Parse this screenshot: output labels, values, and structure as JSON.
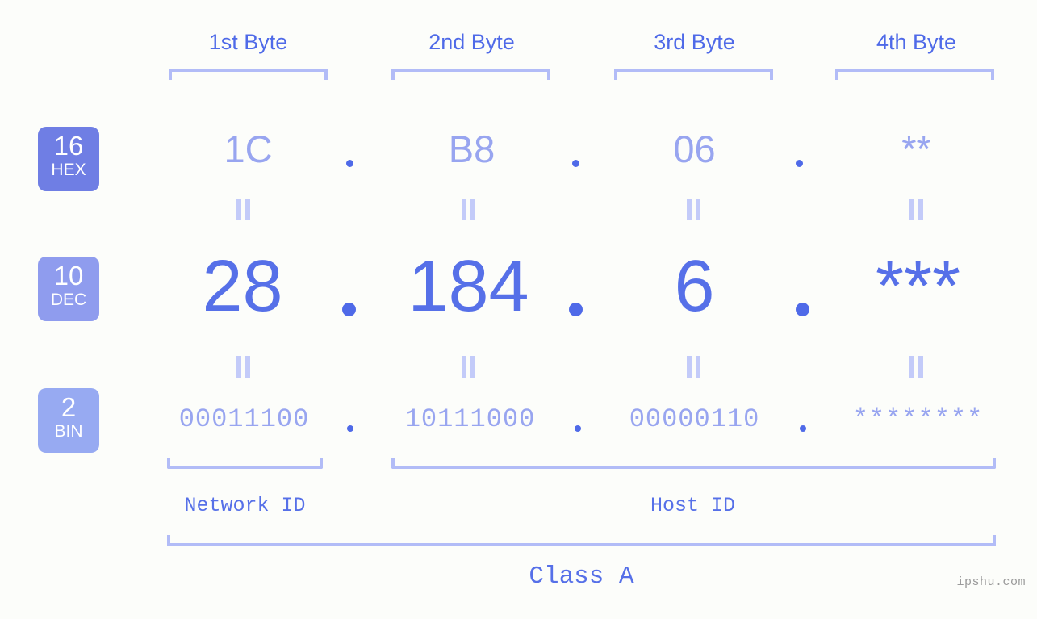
{
  "background_color": "#fcfdfa",
  "accent_colors": {
    "strong_blue": "#5670e8",
    "mid_blue": "#98a5f0",
    "light_lavender": "#b2bcf7",
    "badge_hex": "#6f7ee4",
    "badge_dec": "#8f9cee",
    "badge_bin": "#97aaf2",
    "dot": "#4f6ae8",
    "watermark": "#9a9a9a"
  },
  "byte_headers": [
    {
      "label": "1st Byte"
    },
    {
      "label": "2nd Byte"
    },
    {
      "label": "3rd Byte"
    },
    {
      "label": "4th Byte"
    }
  ],
  "bases": [
    {
      "number": "16",
      "name": "HEX"
    },
    {
      "number": "10",
      "name": "DEC"
    },
    {
      "number": "2",
      "name": "BIN"
    }
  ],
  "rows": {
    "hex": {
      "base_number": "16",
      "base_name": "HEX",
      "values": [
        "1C",
        "B8",
        "06",
        "**"
      ],
      "separator": "."
    },
    "dec": {
      "base_number": "10",
      "base_name": "DEC",
      "values": [
        "28",
        "184",
        "6",
        "***"
      ],
      "separator": "."
    },
    "bin": {
      "base_number": "2",
      "base_name": "BIN",
      "values": [
        "00011100",
        "10111000",
        "00000110",
        "********"
      ],
      "separator": "."
    }
  },
  "equals_marks": {
    "glyph": "||",
    "count_per_row": 4
  },
  "id_sections": [
    {
      "label": "Network ID"
    },
    {
      "label": "Host ID"
    }
  ],
  "class_label": "Class A",
  "watermark": "ipshu.com"
}
